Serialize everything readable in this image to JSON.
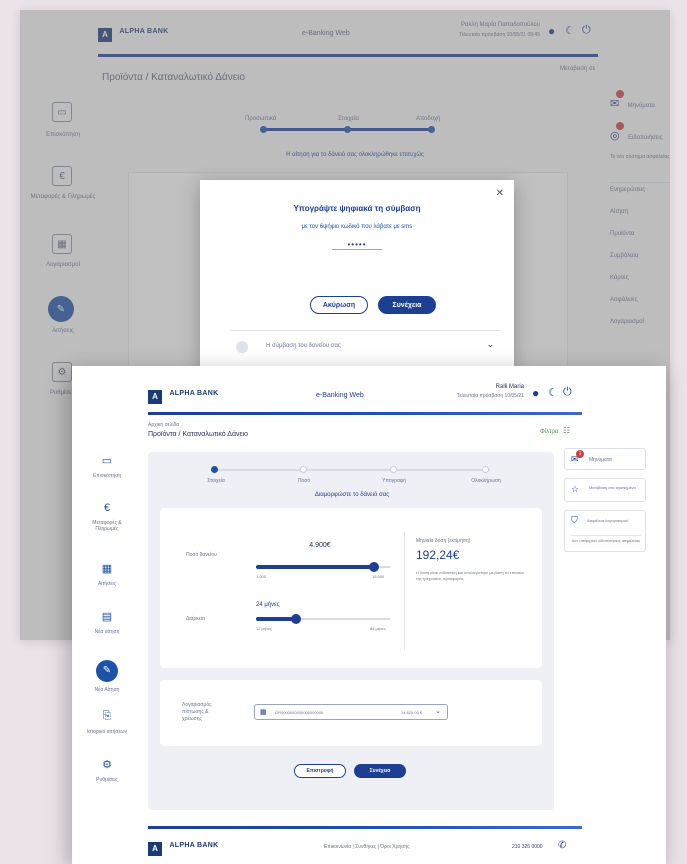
{
  "brand": {
    "name": "ALPHA BANK",
    "logo_letter": "A"
  },
  "back": {
    "center_title": "e-Banking Web",
    "user_line1": "Ραλλη Μαρία Παπαδοπούλου",
    "user_line2": "Τελευταία πρόσβαση 10/05/21 09:45",
    "breadcrumb": "Προϊόντα / Καταναλωτικό Δάνειο",
    "top_right": "Μετάβαση σε",
    "sidebar": [
      "Επισκόπηση",
      "Μεταφορές & Πληρωμές",
      "Λογαριασμοί",
      "Αιτήσεις",
      "Ρυθμίσεις"
    ],
    "stepper_labels": [
      "Προσωπικά",
      "Στοιχεία",
      "Αποδοχή"
    ],
    "stepper_caption": "Η αίτηση για το δάνειό σας ολοκληρώθηκε επιτυχώς",
    "right_items": [
      "Μηνύματα",
      "Ειδοποιήσεις",
      "Το νέο σύστημα ασφαλείας",
      "Ενημερώσεις",
      "Αίτηση",
      "Προϊόντα",
      "Συμβόλαια",
      "Κάρτες",
      "Ασφάλειες",
      "Λογαριασμοί"
    ],
    "modal": {
      "title": "Υπογράψτε ψηφιακά τη σύμβαση",
      "subtitle": "με τον 6ψήφιο κωδικό που λάβατε με sms",
      "code": "•••••",
      "cancel": "Ακύρωση",
      "confirm": "Συνέχεια",
      "close": "✕",
      "accordion": "Η σύμβαση του δανείου σας"
    }
  },
  "front": {
    "center_title": "e-Banking Web",
    "user_name": "Ralli Maria",
    "user_sub": "Τελευταία πρόσβαση 10/05/21",
    "breadcrumb_small": "Αρχική σελίδα",
    "breadcrumb": "Προϊόντα / Καταναλωτικό Δάνειο",
    "filter": "Φίλτρα",
    "sidebar": [
      {
        "label": "Επισκόπηση",
        "icon": "monitor-icon",
        "glyph": "▭"
      },
      {
        "label": "Μεταφορές & Πληρωμές",
        "icon": "transfer-icon",
        "glyph": "€"
      },
      {
        "label": "Αιτήσεις",
        "icon": "calendar-icon",
        "glyph": "▦"
      },
      {
        "label": "Νέα αίτηση",
        "icon": "form-icon",
        "glyph": "▤"
      },
      {
        "label": "Νέα Αίτηση",
        "icon": "document-edit-icon",
        "glyph": "✎"
      },
      {
        "label": "Ιστορικό αιτήσεων",
        "icon": "history-icon",
        "glyph": "⎘"
      },
      {
        "label": "Ρυθμίσεις",
        "icon": "gear-icon",
        "glyph": "⚙"
      }
    ],
    "steps": [
      "Στοιχεία",
      "Ποσό",
      "Υπογραφή",
      "Ολοκλήρωση"
    ],
    "step_title": "Διαμορφώστε το δάνειό σας",
    "amount": {
      "label": "Ποσό δανείου",
      "value": "4.900€",
      "min": "1.000",
      "max": "15.000",
      "fraction": 0.88
    },
    "duration": {
      "label": "Διάρκεια",
      "value": "24 μήνες",
      "min": "12 μήνες",
      "max": "84 μήνες",
      "fraction": 0.3
    },
    "installment": {
      "label": "Μηνιαία δόση (εκτίμηση)",
      "value": "192,24€",
      "note": "Η δόση είναι ενδεικτική και υπολογίστηκε με βάση το επιτόκιο της τρέχουσας προσφοράς"
    },
    "account": {
      "label": "Λογαριασμός πίστωσης & χρέωσης",
      "value": "GR0000000000000000000",
      "balance": "14.820,00 €"
    },
    "buttons": {
      "back": "Επιστροφή",
      "next": "Συνέχεια"
    },
    "right": {
      "messages": "Μηνύματα",
      "messages_count": "1",
      "favorites": "Μετάβαση στα αγαπημένα",
      "security": "Ασφάλεια λογαριασμού",
      "security_note": "Δεν υπάρχουν ειδοποιήσεις ασφαλείας"
    },
    "footer": "Επικοινωνία | Συνθήκες | Όροι Χρήσης",
    "footer_phone": "210 326 0000"
  },
  "colors": {
    "brand": "#1c3f94",
    "accent": "#1c52a8",
    "background": "#ece2ea",
    "badge": "#d33c3c"
  }
}
